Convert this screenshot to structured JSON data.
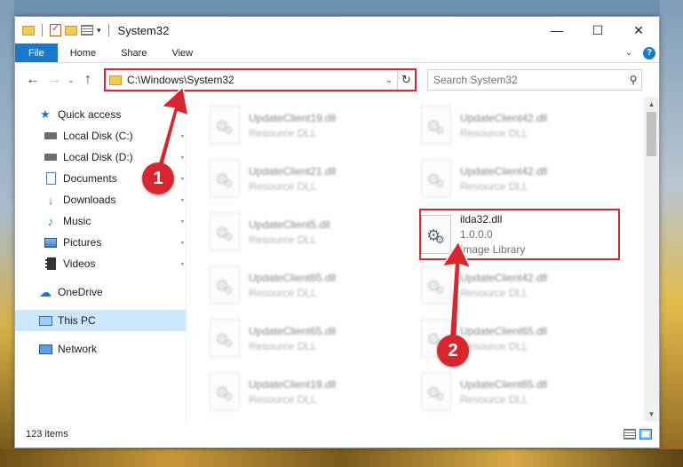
{
  "window": {
    "title": "System32",
    "controls": {
      "minimize": "—",
      "maximize": "☐",
      "close": "✕"
    }
  },
  "ribbon": {
    "tabs": [
      "File",
      "Home",
      "Share",
      "View"
    ],
    "expand_glyph": "⌄",
    "help_glyph": "?"
  },
  "nav": {
    "back_glyph": "←",
    "forward_glyph": "→",
    "history_glyph": "⌄",
    "up_glyph": "↑",
    "address": "C:\\Windows\\System32",
    "address_drop_glyph": "⌄",
    "refresh_glyph": "↻",
    "search_placeholder": "Search System32",
    "search_glyph": "⚲"
  },
  "sidebar": {
    "items": [
      {
        "label": "Quick access",
        "icon": "star-icon",
        "pinned": false
      },
      {
        "label": "Local Disk (C:)",
        "icon": "disk-icon",
        "pinned": true
      },
      {
        "label": "Local Disk (D:)",
        "icon": "disk-icon",
        "pinned": true
      },
      {
        "label": "Documents",
        "icon": "documents-icon",
        "pinned": true
      },
      {
        "label": "Downloads",
        "icon": "downloads-icon",
        "pinned": true
      },
      {
        "label": "Music",
        "icon": "music-icon",
        "pinned": true
      },
      {
        "label": "Pictures",
        "icon": "pictures-icon",
        "pinned": true
      },
      {
        "label": "Videos",
        "icon": "videos-icon",
        "pinned": true
      },
      {
        "label": "OneDrive",
        "icon": "onedrive-icon",
        "pinned": false
      },
      {
        "label": "This PC",
        "icon": "this-pc-icon",
        "pinned": false,
        "selected": true
      },
      {
        "label": "Network",
        "icon": "network-icon",
        "pinned": false
      }
    ],
    "pin_glyph": "📌"
  },
  "files": {
    "left_column": [
      {
        "name": "UpdateClient19.dll",
        "type": "Resource DLL"
      },
      {
        "name": "UpdateClient21.dll",
        "type": "Resource DLL"
      },
      {
        "name": "UpdateClient5.dll",
        "type": "Resource DLL"
      },
      {
        "name": "UpdateClient65.dll",
        "type": "Resource DLL"
      },
      {
        "name": "UpdateClient65.dll",
        "type": "Resource DLL"
      },
      {
        "name": "UpdateClient19.dll",
        "type": "Resource DLL"
      }
    ],
    "right_column": [
      {
        "name": "UpdateClient42.dll",
        "type": "Resource DLL"
      },
      {
        "name": "UpdateClient42.dll",
        "type": "Resource DLL"
      },
      {
        "name": "ilda32.dll",
        "version": "1.0.0.0",
        "type": "Image Library",
        "focus": true
      },
      {
        "name": "UpdateClient42.dll",
        "type": "Resource DLL"
      },
      {
        "name": "UpdateClient65.dll",
        "type": "Resource DLL"
      },
      {
        "name": "UpdateClient65.dll",
        "type": "Resource DLL"
      }
    ]
  },
  "scrollbar": {
    "up_glyph": "▲",
    "down_glyph": "▼"
  },
  "status": {
    "item_count": "123 items"
  },
  "callouts": {
    "first": "1",
    "second": "2"
  },
  "colors": {
    "accent": "#1979ca",
    "highlight": "#d9262e",
    "selected": "#cce8ff"
  }
}
